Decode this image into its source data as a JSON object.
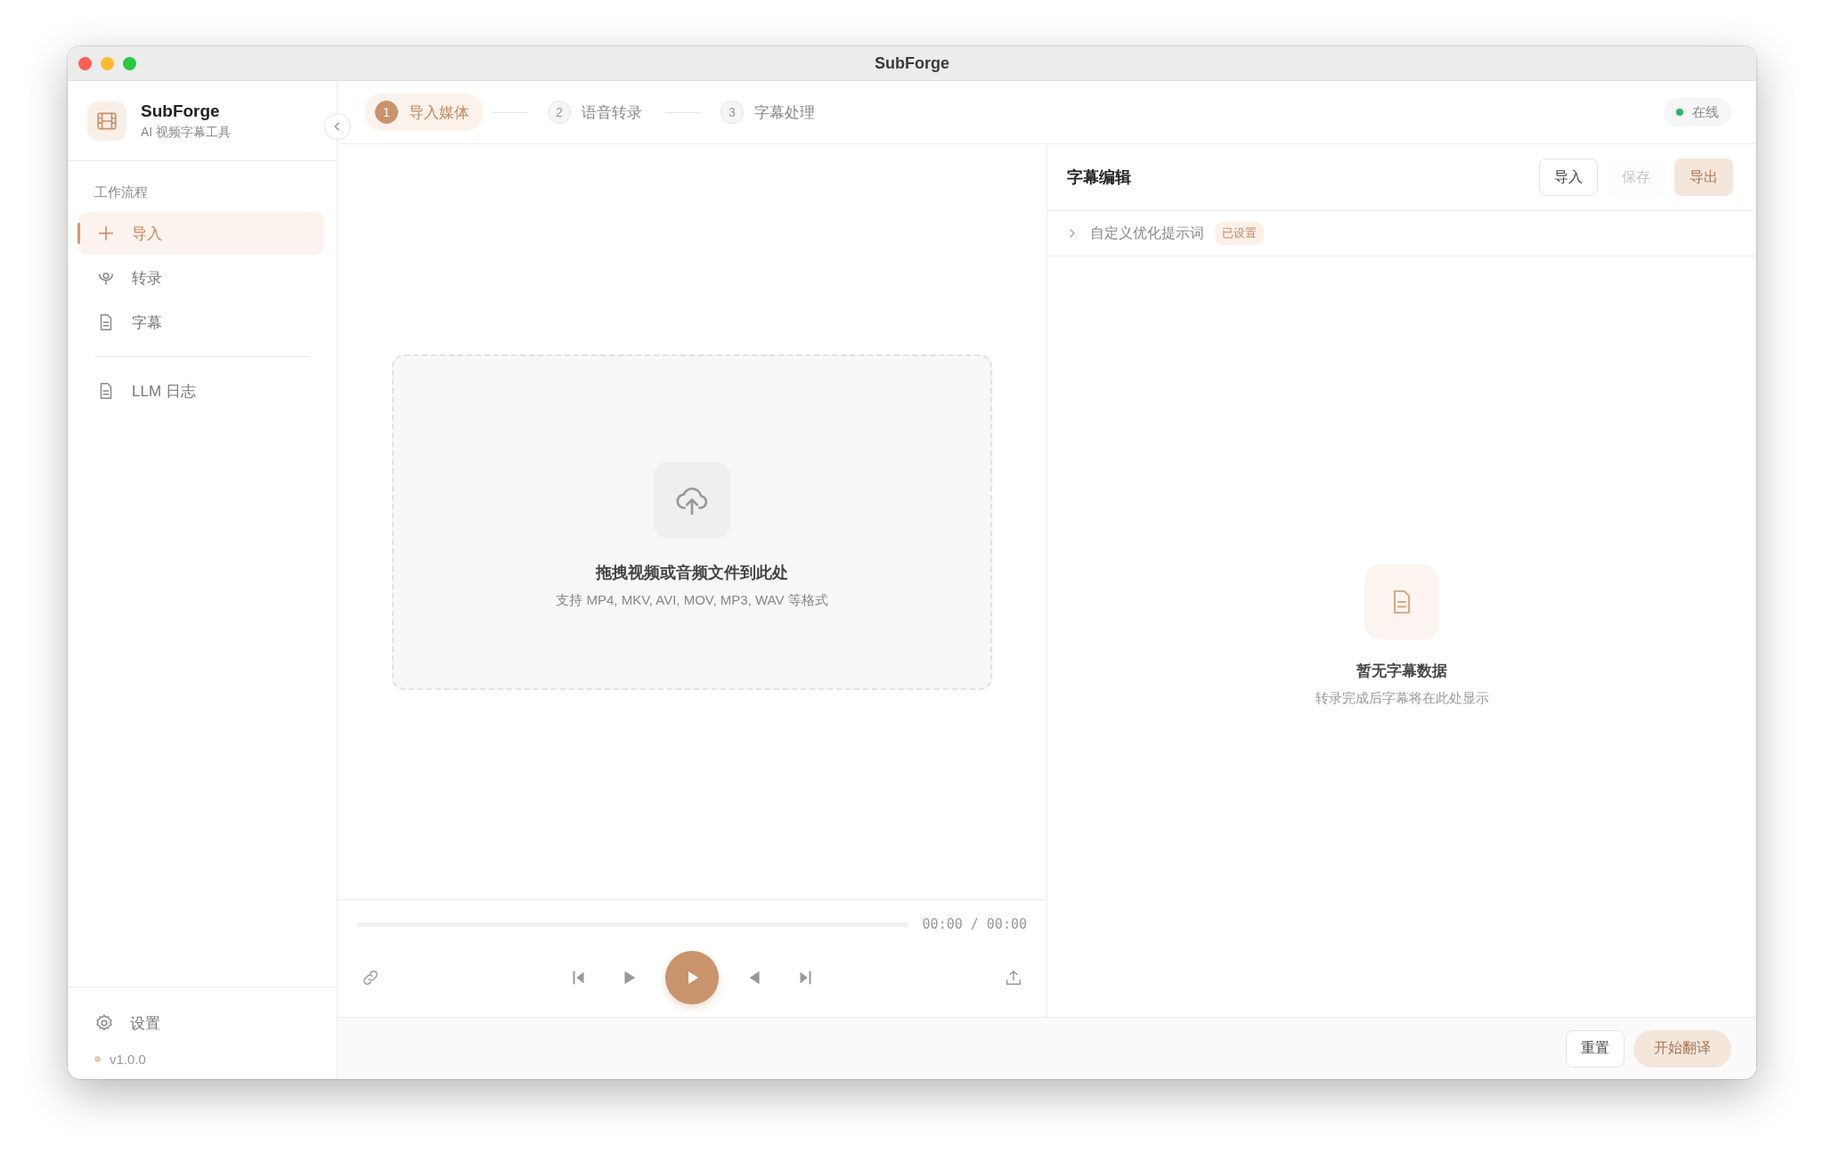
{
  "window": {
    "title": "SubForge"
  },
  "sidebar": {
    "app_name": "SubForge",
    "app_subtitle": "AI 视频字幕工具",
    "section_label": "工作流程",
    "workflow_items": [
      {
        "label": "导入",
        "selected": true
      },
      {
        "label": "转录",
        "selected": false
      },
      {
        "label": "字幕",
        "selected": false
      }
    ],
    "extra_items": [
      {
        "label": "LLM 日志",
        "selected": false
      }
    ],
    "settings": {
      "label": "设置"
    },
    "version": "v1.0.0"
  },
  "steps": [
    {
      "number": "1",
      "label": "导入媒体",
      "selected": true
    },
    {
      "number": "2",
      "label": "语音转录",
      "selected": false
    },
    {
      "number": "3",
      "label": "字幕处理",
      "selected": false
    }
  ],
  "status": {
    "label": "在线",
    "online": true
  },
  "drop_zone": {
    "title": "拖拽视频或音频文件到此处",
    "hint": "支持 MP4, MKV, AVI, MOV, MP3, WAV 等格式"
  },
  "player": {
    "level": 0,
    "time": "00:00 / 00:00"
  },
  "subtitle_editor": {
    "title": "字幕编辑",
    "buttons": [
      {
        "label": "导入",
        "kind": "outline",
        "disabled": false
      },
      {
        "label": "保存",
        "kind": "plain",
        "disabled": true
      },
      {
        "label": "导出",
        "kind": "primary",
        "disabled": true
      }
    ],
    "prompt": {
      "label": "自定义优化提示词",
      "expanded": false,
      "badge": "已设置"
    },
    "empty_state": {
      "title": "暂无字幕数据",
      "hint": "转录完成后字幕将在此处显示"
    }
  },
  "footer": {
    "buttons": [
      {
        "label": "重置",
        "kind": "outline",
        "disabled": false
      },
      {
        "label": "开始翻译",
        "kind": "primary",
        "disabled": true
      }
    ]
  }
}
